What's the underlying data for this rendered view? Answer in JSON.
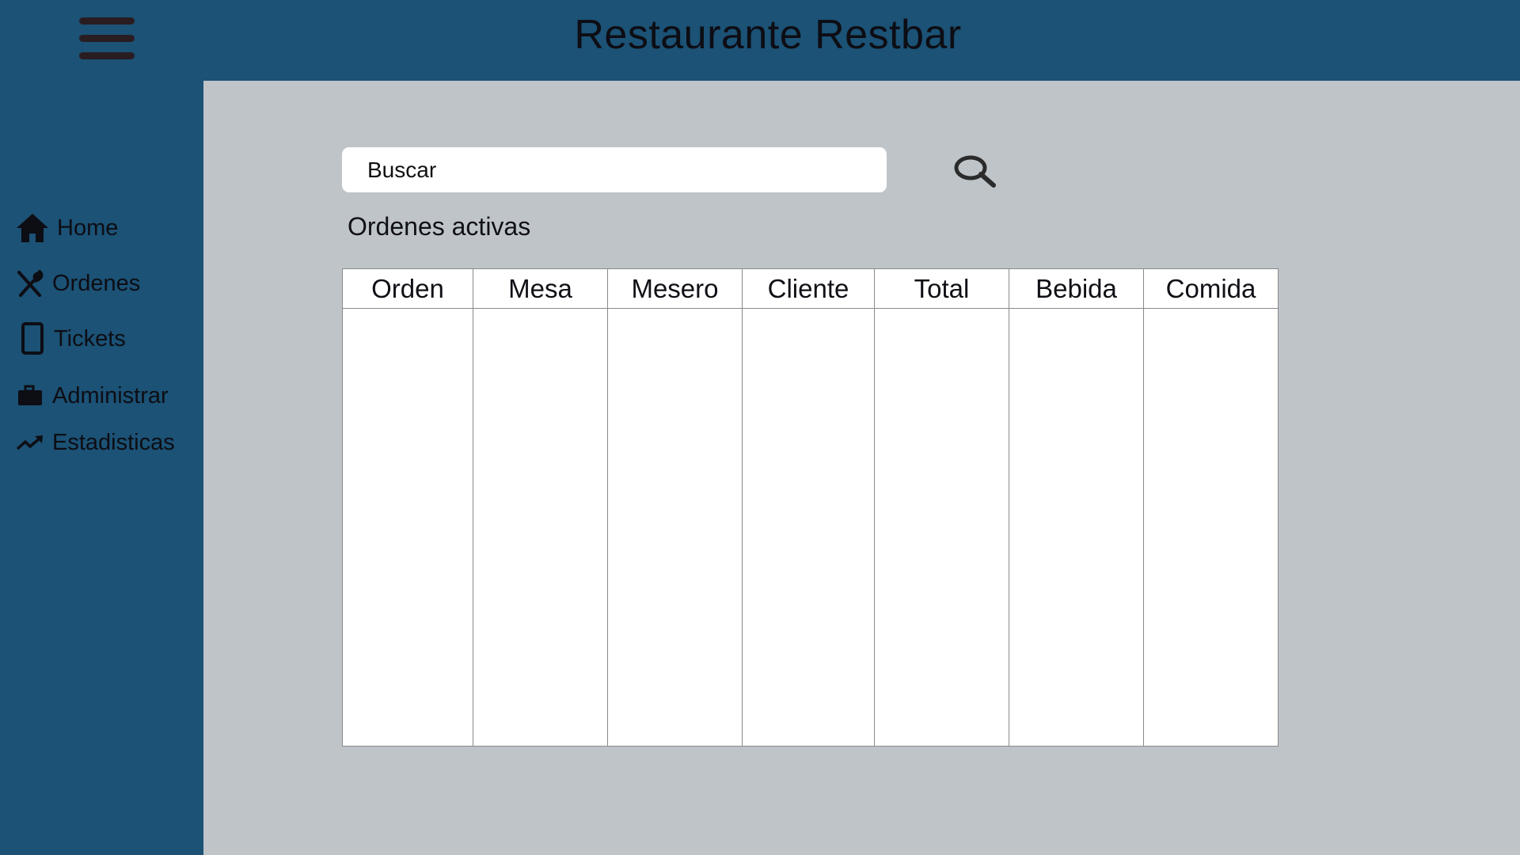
{
  "header": {
    "title": "Restaurante Restbar",
    "menu_icon": "hamburger-menu-icon"
  },
  "sidebar": {
    "items": [
      {
        "label": "Home",
        "icon": "home-icon"
      },
      {
        "label": "Ordenes",
        "icon": "utensils-icon"
      },
      {
        "label": "Tickets",
        "icon": "tablet-icon"
      },
      {
        "label": "Administrar",
        "icon": "briefcase-icon"
      },
      {
        "label": "Estadisticas",
        "icon": "trending-up-icon"
      }
    ]
  },
  "search": {
    "placeholder": "Buscar",
    "icon": "search-icon"
  },
  "orders": {
    "title": "Ordenes activas",
    "columns": [
      "Orden",
      "Mesa",
      "Mesero",
      "Cliente",
      "Total",
      "Bebida",
      "Comida"
    ],
    "rows": []
  },
  "colors": {
    "header_bg": "#1b5275",
    "sidebar_bg": "#1b5275",
    "content_bg": "#bec4c8",
    "table_bg": "#ffffff",
    "search_bg": "#ffffff",
    "icon_color": "#0d0d14"
  }
}
